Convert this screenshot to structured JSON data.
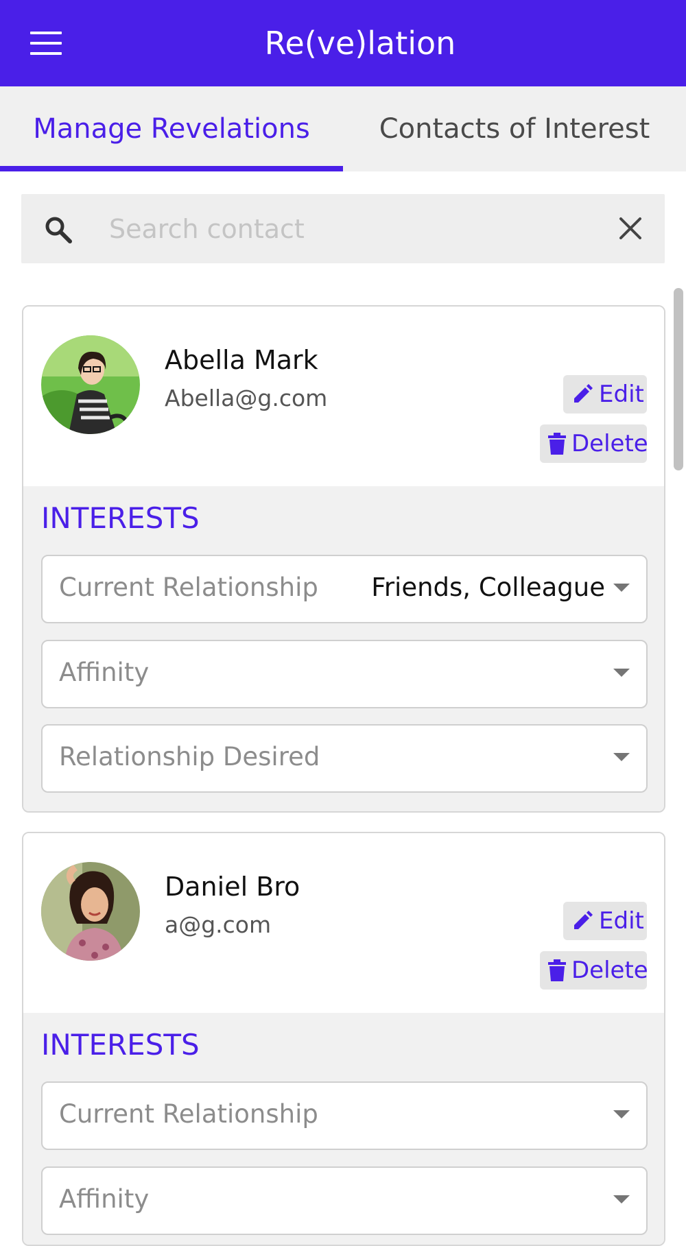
{
  "app": {
    "title": "Re(ve)lation"
  },
  "tabs": [
    {
      "label": "Manage Revelations",
      "active": true
    },
    {
      "label": "Contacts of Interest",
      "active": false
    }
  ],
  "search": {
    "placeholder": "Search contact",
    "value": ""
  },
  "theme": {
    "accent": "#4a1fe8",
    "tab_bg": "#f0f0f0",
    "card_body_bg": "#f1f1f1"
  },
  "contacts": [
    {
      "name": "Abella Mark",
      "email": "Abella@g.com",
      "edit_label": "Edit",
      "delete_label": "Delete",
      "interests_label": "INTERESTS",
      "fields": [
        {
          "placeholder": "Current Relationship",
          "value": "Friends, Colleague"
        },
        {
          "placeholder": "Affinity",
          "value": ""
        },
        {
          "placeholder": "Relationship Desired",
          "value": ""
        }
      ]
    },
    {
      "name": "Daniel Bro",
      "email": "a@g.com",
      "edit_label": "Edit",
      "delete_label": "Delete",
      "interests_label": "INTERESTS",
      "fields": [
        {
          "placeholder": "Current Relationship",
          "value": ""
        },
        {
          "placeholder": "Affinity",
          "value": ""
        }
      ]
    }
  ]
}
